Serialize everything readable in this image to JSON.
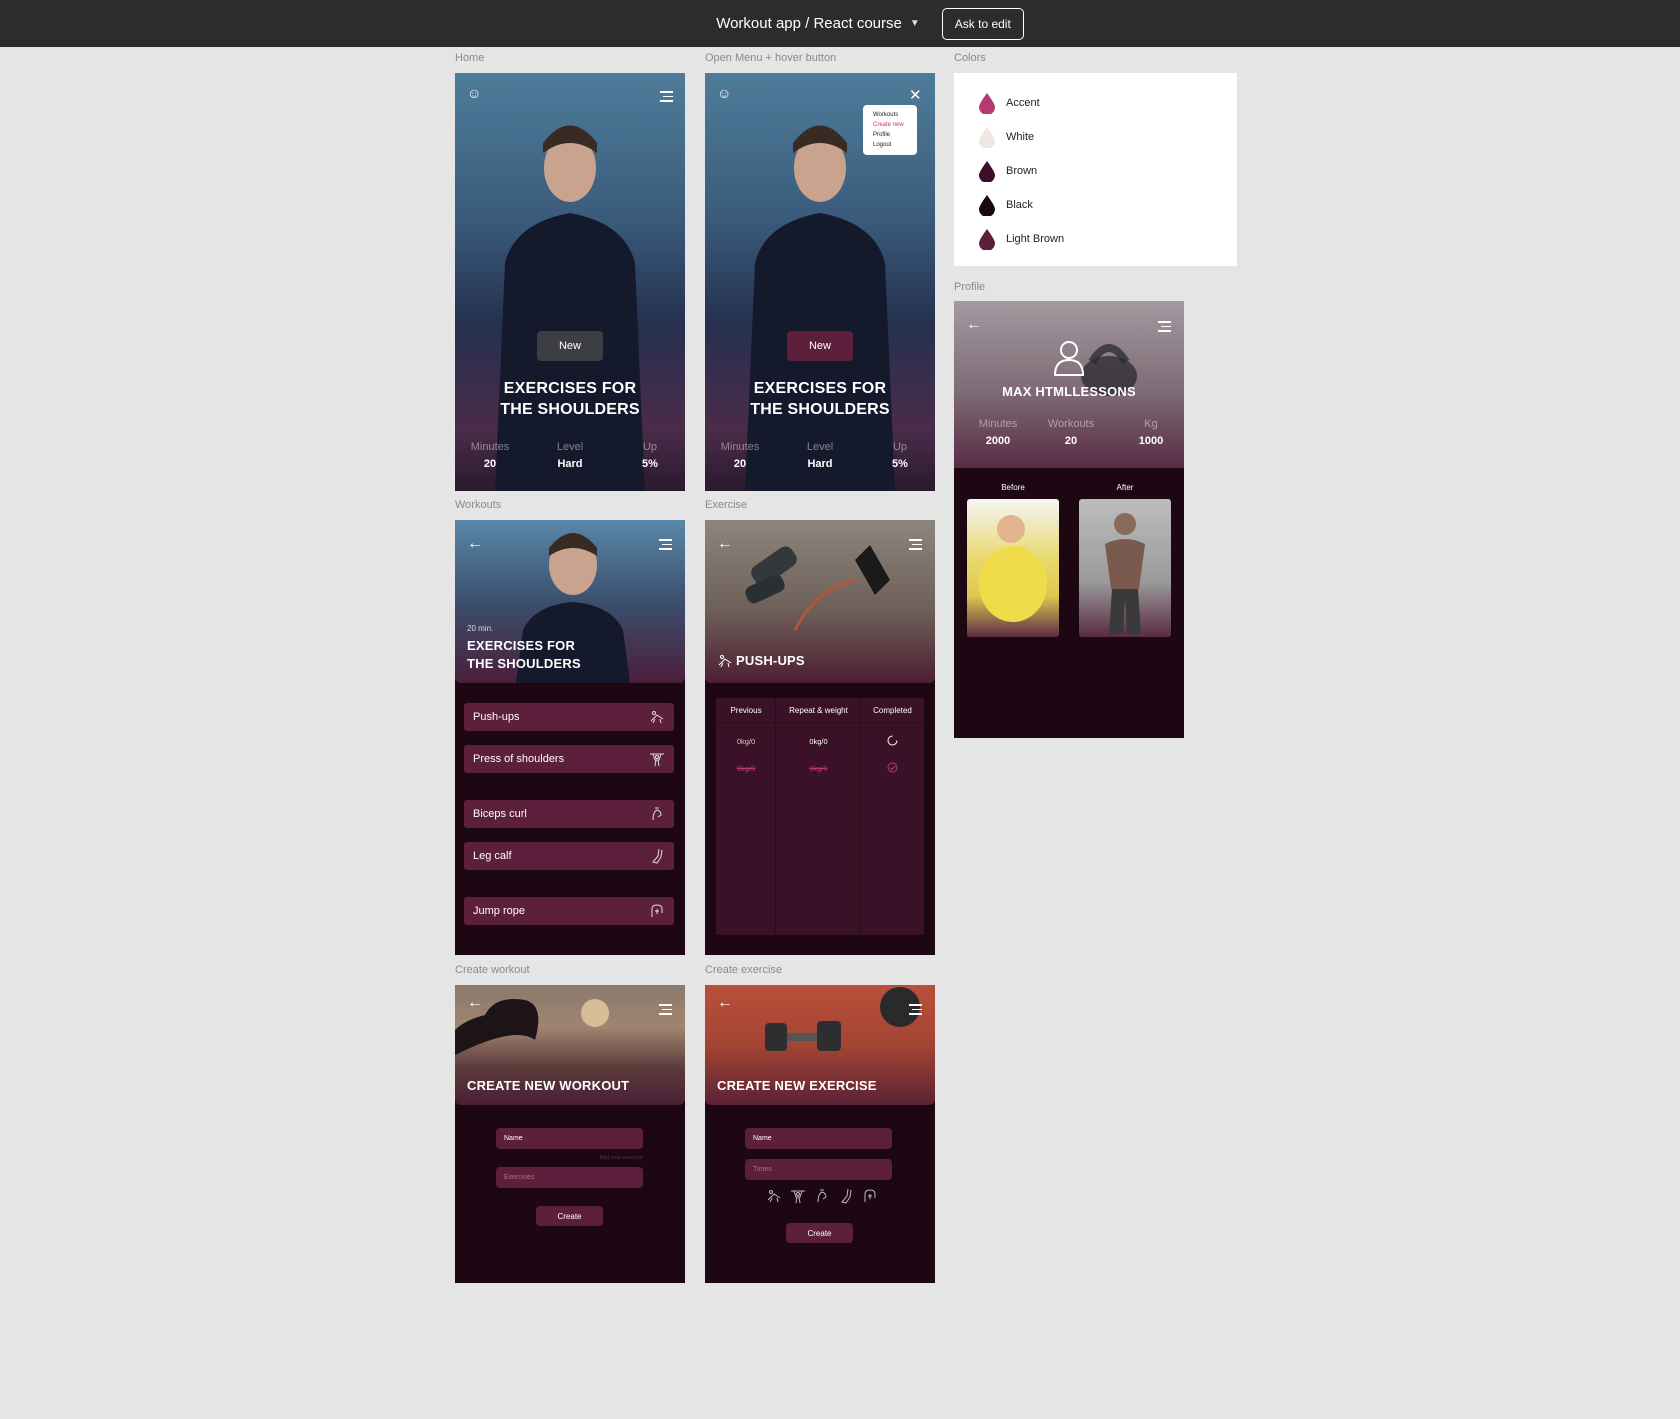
{
  "topbar": {
    "title": "Workout app / React course",
    "ask_label": "Ask to edit"
  },
  "frames": {
    "home": {
      "label": "Home",
      "new_label": "New",
      "title_line1": "EXERCISES FOR",
      "title_line2": "THE SHOULDERS",
      "stats": [
        {
          "k": "Minutes",
          "v": "20"
        },
        {
          "k": "Level",
          "v": "Hard"
        },
        {
          "k": "Up",
          "v": "5%"
        }
      ]
    },
    "menu": {
      "label": "Open Menu + hover button",
      "new_label": "New",
      "title_line1": "EXERCISES FOR",
      "title_line2": "THE SHOULDERS",
      "items": [
        "Workouts",
        "Create new",
        "Profile",
        "Logout"
      ],
      "stats": [
        {
          "k": "Minutes",
          "v": "20"
        },
        {
          "k": "Level",
          "v": "Hard"
        },
        {
          "k": "Up",
          "v": "5%"
        }
      ]
    },
    "workouts": {
      "label": "Workouts",
      "time": "20 min.",
      "title_line1": "EXERCISES FOR",
      "title_line2": "THE SHOULDERS",
      "items": [
        "Push-ups",
        "Press of shoulders",
        "Biceps curl",
        "Leg calf",
        "Jump rope"
      ]
    },
    "exercise": {
      "label": "Exercise",
      "title": "PUSH-UPS",
      "headers": [
        "Previous",
        "Repeat & weight",
        "Completed"
      ],
      "rows": [
        [
          "0kg/0",
          "0kg/0"
        ],
        [
          "0kg/0",
          "0kg/0"
        ]
      ]
    },
    "colors": {
      "label": "Colors",
      "swatches": [
        {
          "name": "Accent",
          "color": "#b43a74"
        },
        {
          "name": "White",
          "color": "#f1e6e2"
        },
        {
          "name": "Brown",
          "color": "#3b0f27"
        },
        {
          "name": "Black",
          "color": "#1c0613"
        },
        {
          "name": "Light Brown",
          "color": "#5c1f3c"
        }
      ]
    },
    "profile": {
      "label": "Profile",
      "name": "MAX HTMLLESSONS",
      "stats": [
        {
          "k": "Minutes",
          "v": "2000"
        },
        {
          "k": "Workouts",
          "v": "20"
        },
        {
          "k": "Kg",
          "v": "1000"
        }
      ],
      "before": "Before",
      "after": "After"
    },
    "create_workout": {
      "label": "Create workout",
      "title": "CREATE NEW WORKOUT",
      "name_placeholder": "Name",
      "add_new": "Add new exercise",
      "exercises_placeholder": "Exercises",
      "create": "Create"
    },
    "create_exercise": {
      "label": "Create exercise",
      "title": "CREATE NEW EXERCISE",
      "name_placeholder": "Name",
      "times_placeholder": "Times",
      "create": "Create"
    }
  },
  "theme": {
    "accent": "#b43a74",
    "brown": "#3b0f27",
    "black": "#1c0613",
    "light_brown": "#5c1f3c"
  }
}
